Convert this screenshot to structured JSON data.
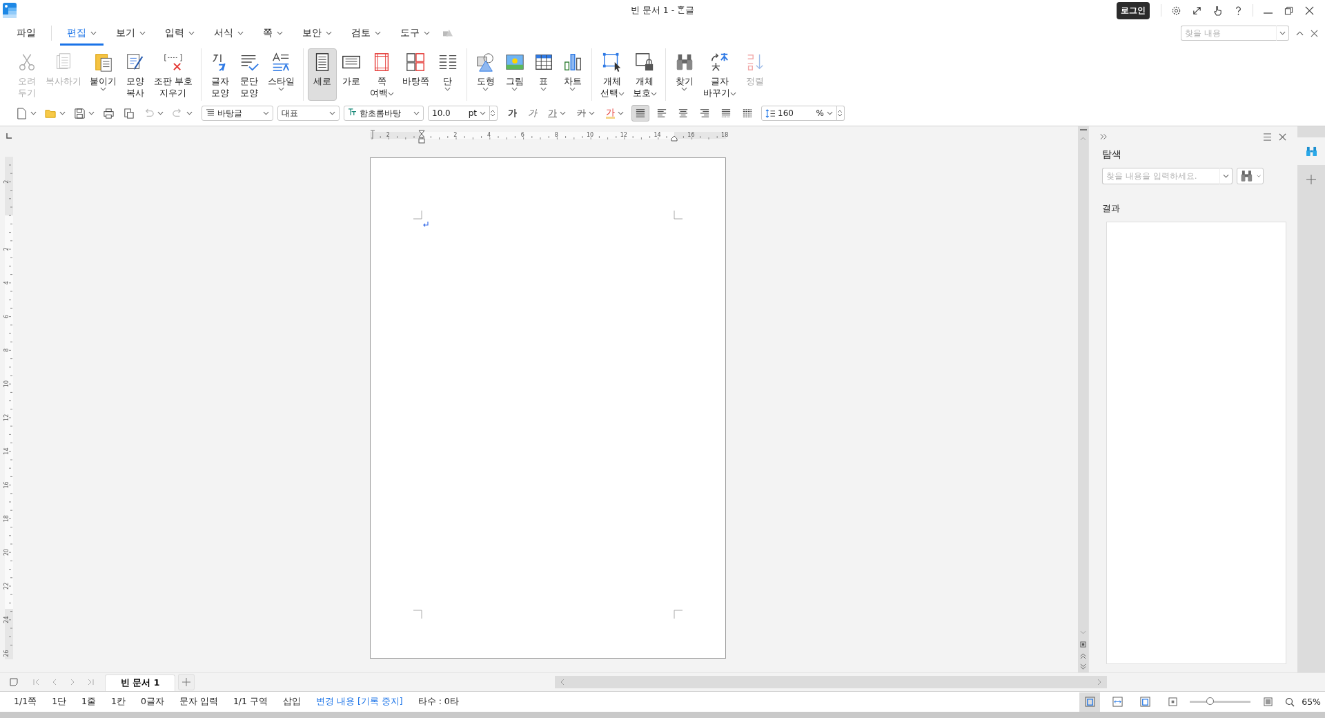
{
  "window": {
    "title": "빈 문서 1 - ᄒᆞᆫ글",
    "login": "로그인"
  },
  "quick_find": {
    "placeholder": "찾을 내용"
  },
  "menu": [
    {
      "label": "파일",
      "selected": false,
      "dropdown": false
    },
    {
      "label": "편집",
      "selected": true,
      "dropdown": true
    },
    {
      "label": "보기",
      "selected": false,
      "dropdown": true
    },
    {
      "label": "입력",
      "selected": false,
      "dropdown": true
    },
    {
      "label": "서식",
      "selected": false,
      "dropdown": true
    },
    {
      "label": "쪽",
      "selected": false,
      "dropdown": true
    },
    {
      "label": "보안",
      "selected": false,
      "dropdown": true
    },
    {
      "label": "검토",
      "selected": false,
      "dropdown": true
    },
    {
      "label": "도구",
      "selected": false,
      "dropdown": true
    }
  ],
  "ribbon": [
    [
      {
        "kind": "cut",
        "label": "오려\n두기",
        "dropdown": false,
        "disabled": true,
        "selected": false
      },
      {
        "kind": "copy",
        "label": "복사하기",
        "dropdown": false,
        "disabled": true,
        "selected": false
      },
      {
        "kind": "paste",
        "label": "붙이기",
        "dropdown": true,
        "disabled": false,
        "selected": false
      },
      {
        "kind": "format-copy",
        "label": "모양\n복사",
        "dropdown": false,
        "disabled": false,
        "selected": false
      },
      {
        "kind": "clear-marks",
        "label": "조판 부호\n지우기",
        "dropdown": false,
        "disabled": false,
        "selected": false
      }
    ],
    [
      {
        "kind": "char-shape",
        "label": "글자\n모양",
        "dropdown": false,
        "disabled": false,
        "selected": false
      },
      {
        "kind": "para-shape",
        "label": "문단\n모양",
        "dropdown": false,
        "disabled": false,
        "selected": false
      },
      {
        "kind": "style",
        "label": "스타일",
        "dropdown": true,
        "disabled": false,
        "selected": false
      }
    ],
    [
      {
        "kind": "portrait",
        "label": "세로",
        "dropdown": false,
        "disabled": false,
        "selected": true
      },
      {
        "kind": "landscape",
        "label": "가로",
        "dropdown": false,
        "disabled": false,
        "selected": false
      },
      {
        "kind": "margin",
        "label": "쪽\n여백",
        "dropdown": true,
        "disabled": false,
        "selected": false
      },
      {
        "kind": "master-page",
        "label": "바탕쪽",
        "dropdown": false,
        "disabled": false,
        "selected": false
      },
      {
        "kind": "columns",
        "label": "단",
        "dropdown": true,
        "disabled": false,
        "selected": false
      }
    ],
    [
      {
        "kind": "shape",
        "label": "도형",
        "dropdown": true,
        "disabled": false,
        "selected": false
      },
      {
        "kind": "picture",
        "label": "그림",
        "dropdown": true,
        "disabled": false,
        "selected": false
      },
      {
        "kind": "table",
        "label": "표",
        "dropdown": true,
        "disabled": false,
        "selected": false
      },
      {
        "kind": "chart",
        "label": "차트",
        "dropdown": true,
        "disabled": false,
        "selected": false
      }
    ],
    [
      {
        "kind": "object-select",
        "label": "개체\n선택",
        "dropdown": true,
        "disabled": false,
        "selected": false
      },
      {
        "kind": "object-protect",
        "label": "개체\n보호",
        "dropdown": true,
        "disabled": false,
        "selected": false
      }
    ],
    [
      {
        "kind": "find",
        "label": "찾기",
        "dropdown": true,
        "disabled": false,
        "selected": false
      },
      {
        "kind": "replace",
        "label": "글자\n바꾸기",
        "dropdown": true,
        "disabled": false,
        "selected": false
      },
      {
        "kind": "sort",
        "label": "정렬",
        "dropdown": false,
        "disabled": true,
        "selected": false
      }
    ]
  ],
  "quick_tools": [
    {
      "kind": "new",
      "dropdown": true,
      "disabled": false
    },
    {
      "kind": "open",
      "dropdown": true,
      "disabled": false
    },
    {
      "kind": "save",
      "dropdown": true,
      "disabled": false
    },
    {
      "kind": "print",
      "dropdown": false,
      "disabled": false
    },
    {
      "kind": "preview",
      "dropdown": false,
      "disabled": false
    },
    {
      "kind": "undo",
      "dropdown": true,
      "disabled": true
    },
    {
      "kind": "redo",
      "dropdown": true,
      "disabled": true
    }
  ],
  "style_box": {
    "value": "바탕글"
  },
  "language_box": {
    "value": "대표"
  },
  "font_box": {
    "value": "함초롬바탕"
  },
  "size_box": {
    "value": "10.0",
    "unit": "pt"
  },
  "format_buttons": [
    {
      "kind": "bold",
      "label": "가",
      "dropdown": false
    },
    {
      "kind": "italic",
      "label": "가",
      "dropdown": false
    },
    {
      "kind": "underline",
      "label": "가",
      "dropdown": true
    },
    {
      "kind": "strike",
      "label": "가",
      "dropdown": true
    },
    {
      "kind": "color",
      "label": "가",
      "dropdown": true
    }
  ],
  "align_buttons": [
    {
      "kind": "justify",
      "selected": true
    },
    {
      "kind": "left",
      "selected": false
    },
    {
      "kind": "center",
      "selected": false
    },
    {
      "kind": "right",
      "selected": false
    },
    {
      "kind": "distribute",
      "selected": false
    },
    {
      "kind": "divide",
      "selected": false
    }
  ],
  "line_spacing": {
    "value": "160",
    "unit": "%"
  },
  "rulers": {
    "horizontal": [
      "2",
      "2",
      "4",
      "6",
      "8",
      "10",
      "12",
      "14",
      "16",
      "18"
    ],
    "vertical": [
      "2",
      "2",
      "4",
      "6",
      "8",
      "10",
      "12",
      "14",
      "16",
      "18",
      "20",
      "22",
      "24",
      "26"
    ]
  },
  "search_panel": {
    "title": "탐색",
    "placeholder": "찾을 내용을 입력하세요.",
    "results_title": "결과"
  },
  "document_tabs": [
    {
      "label": "빈 문서 1",
      "selected": true
    }
  ],
  "status_bar": [
    {
      "text": "1/1쪽",
      "kind": "text"
    },
    {
      "text": "1단",
      "kind": "text"
    },
    {
      "text": "1줄",
      "kind": "text"
    },
    {
      "text": "1칸",
      "kind": "text"
    },
    {
      "text": "0글자",
      "kind": "text"
    },
    {
      "text": "문자 입력",
      "kind": "text"
    },
    {
      "text": "1/1 구역",
      "kind": "text"
    },
    {
      "text": "삽입",
      "kind": "text"
    },
    {
      "text": "변경 내용 [기록 중지]",
      "kind": "link"
    },
    {
      "text": "타수 : 0타",
      "kind": "text"
    }
  ],
  "view_buttons": [
    {
      "kind": "page",
      "selected": true
    },
    {
      "kind": "width",
      "selected": false
    },
    {
      "kind": "whole",
      "selected": false
    }
  ],
  "zoom": {
    "level": 0.33,
    "reading": "65%"
  }
}
